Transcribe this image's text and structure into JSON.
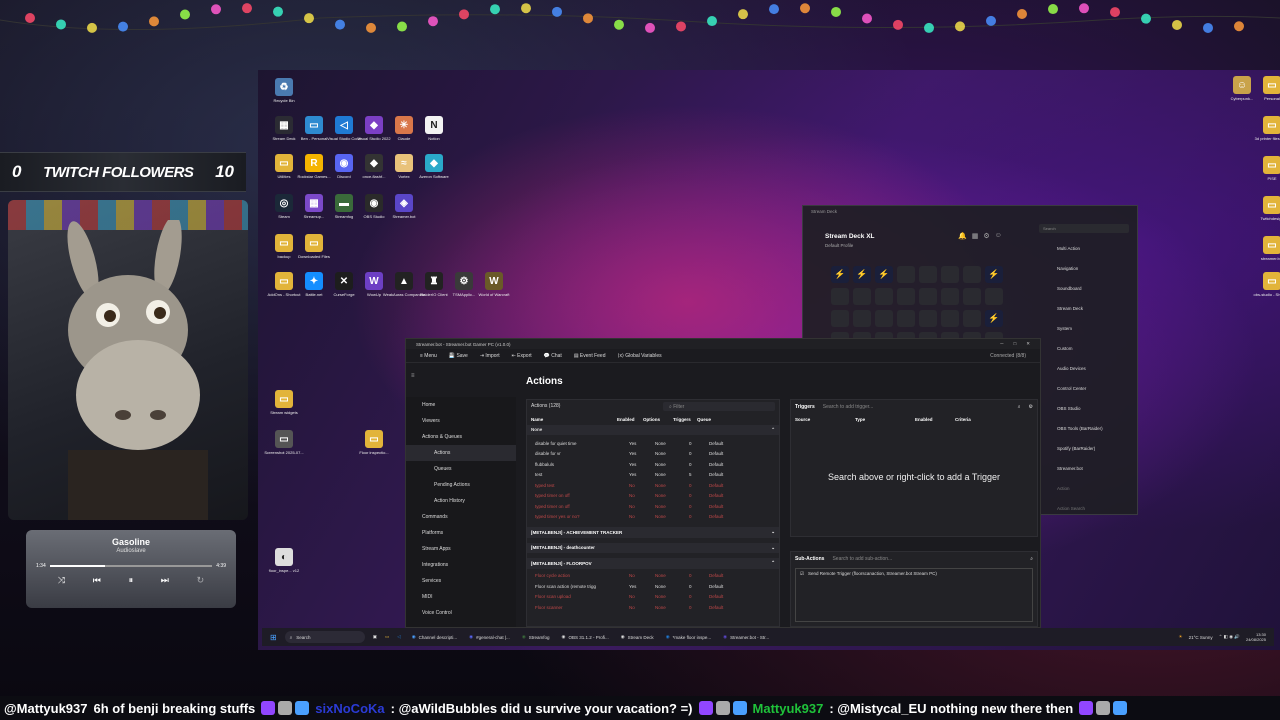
{
  "overlay": {
    "followers": {
      "current": "0",
      "label": "TWITCH FOLLOWERS",
      "goal": "10"
    },
    "music": {
      "title": "Gasoline",
      "artist": "Audioslave",
      "elapsed": "1:34",
      "duration": "4:39",
      "progress": 0.34
    }
  },
  "desktop_icons": [
    {
      "label": "Recycle Bin",
      "color": "#4a7ab0",
      "glyph": "♻"
    },
    {
      "label": "Stream Deck",
      "color": "#2b2b33",
      "glyph": "▦"
    },
    {
      "label": "Ben - Personal",
      "color": "#2e8bd0",
      "glyph": "▭"
    },
    {
      "label": "Visual Studio Code",
      "color": "#1f7ad4",
      "glyph": "◁"
    },
    {
      "label": "Visual Studio 2022",
      "color": "#7b3fc4",
      "glyph": "◆"
    },
    {
      "label": "Claude",
      "color": "#d9774a",
      "glyph": "✳"
    },
    {
      "label": "Notion",
      "color": "#f3f3f3",
      "glyph": "N"
    },
    {
      "label": "Utilities",
      "color": "#e2b43a",
      "glyph": "▭"
    },
    {
      "label": "Rockstar Games...",
      "color": "#f5b400",
      "glyph": "R"
    },
    {
      "label": "Discord",
      "color": "#5865f2",
      "glyph": "◉"
    },
    {
      "label": "once-flashf...",
      "color": "#333",
      "glyph": "◆"
    },
    {
      "label": "Vortex",
      "color": "#e9c27a",
      "glyph": "≈"
    },
    {
      "label": "Azeron Software",
      "color": "#2aa9c9",
      "glyph": "◆"
    },
    {
      "label": "Steam",
      "color": "#1b2838",
      "glyph": "◎"
    },
    {
      "label": "Streamup...",
      "color": "#7b49c9",
      "glyph": "▦"
    },
    {
      "label": "Streamfog",
      "color": "#3a6a3a",
      "glyph": "▬"
    },
    {
      "label": "OBS Studio",
      "color": "#2a2a2a",
      "glyph": "◉"
    },
    {
      "label": "Streamer.bot",
      "color": "#5a46c8",
      "glyph": "◈"
    },
    {
      "label": "backup",
      "color": "#e2b43a",
      "glyph": "▭"
    },
    {
      "label": "Downloaded Files",
      "color": "#e2b43a",
      "glyph": "▭"
    },
    {
      "label": "AddOns - Shortcut",
      "color": "#e2b43a",
      "glyph": "▭"
    },
    {
      "label": "Battle.net",
      "color": "#148eff",
      "glyph": "✦"
    },
    {
      "label": "CurseForge",
      "color": "#1d1d1d",
      "glyph": "✕"
    },
    {
      "label": "WowUp",
      "color": "#6d3fc4",
      "glyph": "W"
    },
    {
      "label": "WeakAuras Companion",
      "color": "#222",
      "glyph": "▲"
    },
    {
      "label": "RaiderIO Client",
      "color": "#222",
      "glyph": "♜"
    },
    {
      "label": "TSMApplic...",
      "color": "#3a3a3a",
      "glyph": "⚙"
    },
    {
      "label": "World of Warcraft",
      "color": "#6a5a28",
      "glyph": "W"
    },
    {
      "label": "Stream widgets",
      "color": "#e2b43a",
      "glyph": "▭"
    },
    {
      "label": "Screenshot 2025-07...",
      "color": "#555",
      "glyph": "▭"
    },
    {
      "label": "Floor inspectio...",
      "color": "#e2b43a",
      "glyph": "▭"
    },
    {
      "label": "floor_inspe... v12",
      "color": "#ddd",
      "glyph": "◐"
    },
    {
      "label": "Cyberpunk...",
      "color": "#c9a34a",
      "glyph": "☺"
    },
    {
      "label": "Personal",
      "color": "#e2b43a",
      "glyph": "▭"
    },
    {
      "label": "3d printer files - S...",
      "color": "#e2b43a",
      "glyph": "▭"
    },
    {
      "label": "PISE",
      "color": "#e2b43a",
      "glyph": "▭"
    },
    {
      "label": "Twitchdesign",
      "color": "#e2b43a",
      "glyph": "▭"
    },
    {
      "label": "streamer.bot",
      "color": "#e2b43a",
      "glyph": "▭"
    },
    {
      "label": "obs-studio - Shortcut",
      "color": "#e2b43a",
      "glyph": "▭"
    }
  ],
  "streamerbot": {
    "window_title": "Streamer.bot - Streamer.bot Gamer PC (v1.0.0)",
    "menu": [
      "Menu",
      "Save",
      "Import",
      "Export",
      "Chat",
      "Event Feed",
      "Global Variables"
    ],
    "connection": "Connected (8/8)",
    "page_title": "Actions",
    "nav": [
      "Home",
      "Viewers",
      "Actions & Queues",
      "Actions",
      "Queues",
      "Pending Actions",
      "Action History",
      "Commands",
      "Platforms",
      "Stream Apps",
      "Integrations",
      "Services",
      "MIDI",
      "Voice Control"
    ],
    "actions": {
      "header": "Actions (128)",
      "filter_placeholder": "Filter",
      "columns": [
        "Name",
        "Enabled",
        "Options",
        "Triggers",
        "Queue"
      ],
      "group_none": "None",
      "rows": [
        {
          "name": "disable for quiet time",
          "enabled": "Yes",
          "options": "None",
          "triggers": "0",
          "queue": "Default",
          "disabled": false
        },
        {
          "name": "disable for vr",
          "enabled": "Yes",
          "options": "None",
          "triggers": "0",
          "queue": "Default",
          "disabled": false
        },
        {
          "name": "flubbaluls",
          "enabled": "Yes",
          "options": "None",
          "triggers": "0",
          "queue": "Default",
          "disabled": false
        },
        {
          "name": "test",
          "enabled": "Yes",
          "options": "None",
          "triggers": "5",
          "queue": "Default",
          "disabled": false
        },
        {
          "name": "typed test",
          "enabled": "No",
          "options": "None",
          "triggers": "0",
          "queue": "Default",
          "disabled": true
        },
        {
          "name": "typed timer on off",
          "enabled": "No",
          "options": "None",
          "triggers": "0",
          "queue": "Default",
          "disabled": true
        },
        {
          "name": "typed timer on off",
          "enabled": "No",
          "options": "None",
          "triggers": "0",
          "queue": "Default",
          "disabled": true
        },
        {
          "name": "typed timer yes or no?",
          "enabled": "No",
          "options": "None",
          "triggers": "0",
          "queue": "Default",
          "disabled": true
        }
      ],
      "groups": [
        "[METALBENJI] - ACHIEVEMENT TRACKER",
        "[METALBENJI] - deathcounter",
        "[METALBENJI] - FLOORPOV"
      ],
      "floor_rows": [
        {
          "name": "Floor cycle action",
          "enabled": "No",
          "options": "None",
          "triggers": "0",
          "queue": "Default",
          "disabled": true
        },
        {
          "name": "Floor scan action (remote trigg",
          "enabled": "Yes",
          "options": "None",
          "triggers": "0",
          "queue": "Default",
          "disabled": false
        },
        {
          "name": "Floor scan upload",
          "enabled": "No",
          "options": "None",
          "triggers": "0",
          "queue": "Default",
          "disabled": true
        },
        {
          "name": "Floor scanner",
          "enabled": "No",
          "options": "None",
          "triggers": "0",
          "queue": "Default",
          "disabled": true
        }
      ]
    },
    "triggers": {
      "header": "Triggers",
      "search_placeholder": "Search to add trigger...",
      "columns": [
        "Source",
        "Type",
        "Enabled",
        "Criteria"
      ],
      "empty_text": "Search above or right-click to add a Trigger"
    },
    "subactions": {
      "header": "Sub-Actions",
      "search_placeholder": "Search to add sub-action...",
      "item": "Send Remote Trigger (floorscanaction, Streamer.bot Stream PC)"
    }
  },
  "streamdeck": {
    "window_title": "Stream Deck",
    "device": "Stream Deck XL",
    "profile": "Default Profile",
    "search_placeholder": "Search",
    "categories": [
      "Multi Action",
      "Navigation",
      "Soundboard",
      "Stream Deck",
      "System",
      "Custom",
      "Audio Devices",
      "Control Center",
      "OBS Studio",
      "OBS Tools (BarRaider)",
      "Spotify (BarRaider)",
      "Streamer.bot",
      "Action",
      "Action Search"
    ]
  },
  "taskbar": {
    "search": "Search",
    "apps": [
      "Channel descripti...",
      "#general-chat |...",
      "Streamfog",
      "OBS 31.1.2 - Profi...",
      "Stream Deck",
      "*make floor inspe...",
      "Streamer.bot - Str..."
    ],
    "weather": "21°C Sunny",
    "time": "13:30",
    "date": "24/08/2025"
  },
  "chat": [
    {
      "user": "@Mattyuk937",
      "text": "6h of benji breaking stuffs",
      "color": "#ffffff"
    },
    {
      "user": "sixNoCoKa",
      "text": ": @aWildBubbles did u survive your vacation? =)",
      "color": "#2b3bd6"
    },
    {
      "user": "Mattyuk937",
      "text": ": @Mistycal_EU nothing new there then",
      "color": "#1fc23a"
    }
  ]
}
